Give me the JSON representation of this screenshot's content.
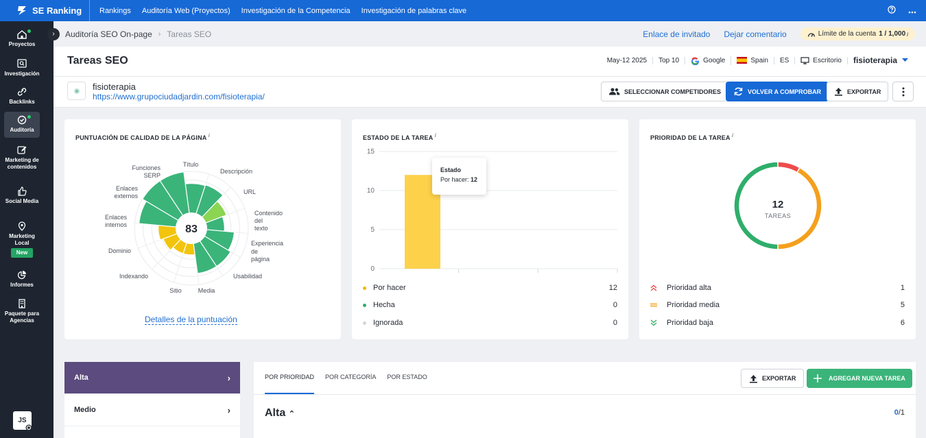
{
  "brand": {
    "name": "SE Ranking",
    "primary": "#1769d6",
    "sidebar_bg": "#1e2530"
  },
  "topnav": [
    "Rankings",
    "Auditoría Web (Proyectos)",
    "Investigación de la Competencia",
    "Investigación de palabras clave"
  ],
  "sidebar": {
    "items": [
      {
        "label": "Proyectos",
        "icon": "home-icon"
      },
      {
        "label": "Investigación",
        "icon": "research-icon"
      },
      {
        "label": "Backlinks",
        "icon": "link-icon"
      },
      {
        "label": "Auditoría",
        "icon": "audit-check-icon"
      },
      {
        "label": "Marketing de contenidos",
        "icon": "edit-icon"
      },
      {
        "label": "Social Media",
        "icon": "thumbs-up-icon"
      },
      {
        "label": "Marketing Local",
        "icon": "location-pin-icon"
      },
      {
        "label": "Informes",
        "icon": "pie-chart-icon"
      },
      {
        "label": "Paquete para Agencias",
        "icon": "building-icon"
      }
    ],
    "new_badge": "New",
    "avatar": "JS"
  },
  "breadcrumb": {
    "parent": "Auditoría SEO On-page",
    "current": "Tareas SEO"
  },
  "actions": {
    "invite": "Enlace de invitado",
    "feedback": "Dejar comentario"
  },
  "limit": {
    "label": "Límite de la cuenta",
    "value": "1 / 1,000",
    "info": "i"
  },
  "page": {
    "title": "Tareas SEO",
    "date": "May-12 2025",
    "top": "Top 10",
    "engine": "Google",
    "country": "Spain",
    "lang": "ES",
    "device": "Escritorio",
    "project": "fisioterapia"
  },
  "site": {
    "name": "fisioterapia",
    "url": "https://www.grupociudadjardin.com/fisioterapia/"
  },
  "buttons": {
    "competitors": "SELECCIONAR COMPETIDORES",
    "recheck": "VOLVER A COMPROBAR",
    "export": "EXPORTAR",
    "add_task": "AGREGAR NUEVA TAREA"
  },
  "quality": {
    "title": "PUNTUACIÓN DE CALIDAD DE LA PÁGINA",
    "score": "83",
    "details_link": "Detalles de la puntuación",
    "labels": {
      "titulo": "Título",
      "descripcion": "Descripción",
      "url": "URL",
      "contenido_1": "Contenido",
      "contenido_2": "del",
      "contenido_3": "texto",
      "experiencia_1": "Experiencia",
      "experiencia_2": "de",
      "experiencia_3": "página",
      "usabilidad": "Usabilidad",
      "media": "Media",
      "sitio": "Sitio",
      "indexando": "Indexando",
      "dominio": "Dominio",
      "enlaces_int_1": "Enlaces",
      "enlaces_int_2": "internos",
      "enlaces_ext_1": "Enlaces",
      "enlaces_ext_2": "externos",
      "funciones_1": "Funciones",
      "funciones_2": "SERP"
    },
    "colors": {
      "good": "#3bb47a",
      "warn": "#f2c40c",
      "mid": "#8bd553"
    }
  },
  "status": {
    "title": "ESTADO DE LA TAREA",
    "tooltip_title": "Estado",
    "tooltip_label": "Por hacer:",
    "tooltip_value": "12",
    "legend": [
      {
        "label": "Por hacer",
        "value": "12",
        "color": "#f6b600"
      },
      {
        "label": "Hecha",
        "value": "0",
        "color": "#2fae6b"
      },
      {
        "label": "Ignorada",
        "value": "0",
        "color": "#d2d5da"
      }
    ]
  },
  "chart_data": {
    "type": "bar",
    "categories": [
      "Por hacer",
      "Hecha",
      "Ignorada"
    ],
    "values": [
      12,
      0,
      0
    ],
    "ylim": [
      0,
      15
    ],
    "yticks": [
      "0",
      "5",
      "10",
      "15"
    ],
    "bar_color": "#fdd14a"
  },
  "priority": {
    "title": "PRIORIDAD DE LA TAREA",
    "total": "12",
    "total_label": "TAREAS",
    "legend": [
      {
        "label": "Prioridad alta",
        "value": "1",
        "color": "#ef4b4b"
      },
      {
        "label": "Prioridad media",
        "value": "5",
        "color": "#f4a01d"
      },
      {
        "label": "Prioridad baja",
        "value": "6",
        "color": "#2fae6b"
      }
    ]
  },
  "bottom": {
    "prio_items": [
      {
        "label": "Alta",
        "chev": "›"
      },
      {
        "label": "Medio",
        "chev": "›"
      }
    ],
    "tabs": [
      "POR PRIORIDAD",
      "POR CATEGORÍA",
      "POR ESTADO"
    ],
    "section_title": "Alta",
    "count_done": "0",
    "count_total": "/1"
  }
}
